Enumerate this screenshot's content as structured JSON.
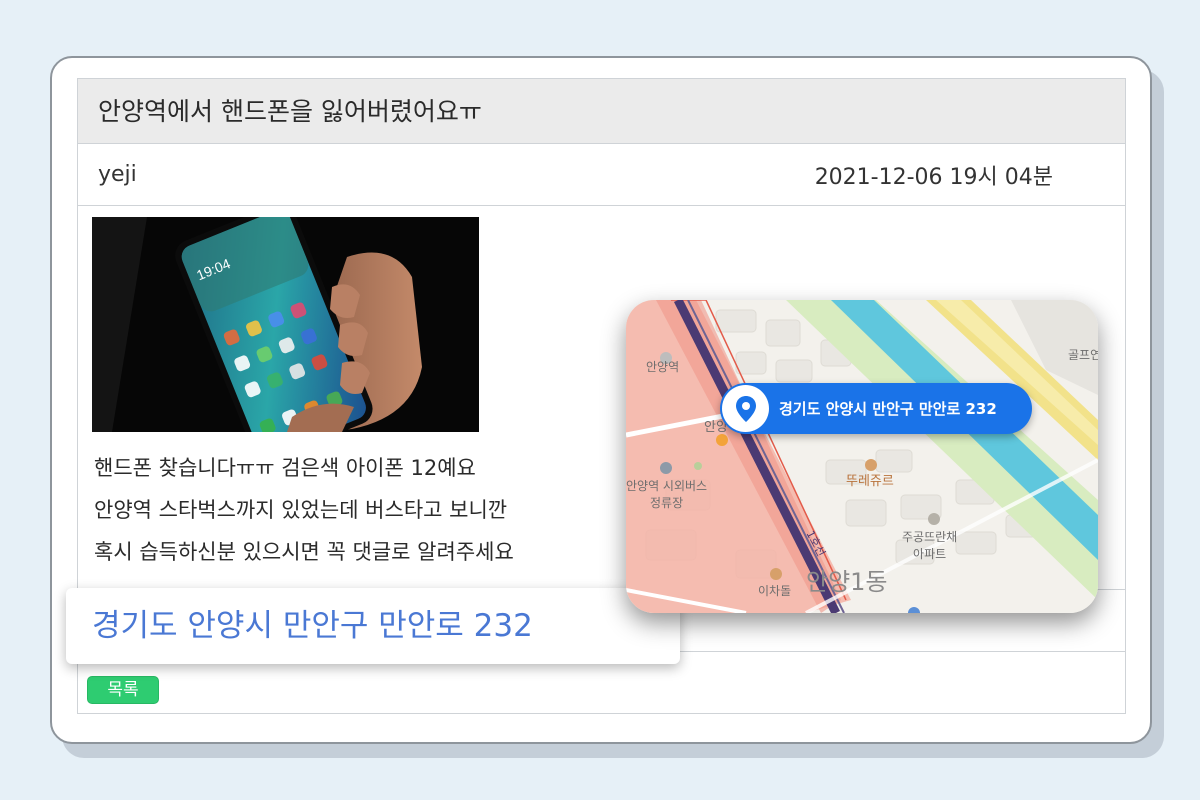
{
  "post": {
    "title": "안양역에서 핸드폰을 잃어버렸어요ㅠ",
    "author": "yeji",
    "timestamp": "2021-12-06 19시 04분",
    "body_lines": [
      "핸드폰 찾습니다ㅠㅠ 검은색 아이폰 12예요",
      "안양역 스타벅스까지 있었는데 버스타고 보니깐",
      "혹시 습득하신분 있으시면 꼭 댓글로 알려주세요"
    ],
    "list_button": "목록"
  },
  "phone_screen_time": "19:04",
  "address_callout": "경기도 안양시 만안구 만안로 232",
  "map": {
    "pin_address": "경기도 안양시 만안구 만안로 232",
    "labels": {
      "station_top": "안양역",
      "station_mid": "안양",
      "bus_stop": "안양역 시외버스\n정류장",
      "restaurant": "뚜레쥬르",
      "apartment": "주공뜨란채\n아파트",
      "district": "안양1동",
      "shop": "이차돌",
      "golf": "골프연",
      "rail_line": "1호선"
    },
    "colors": {
      "station_area": "#f4b3a6",
      "rail": "#4b3a73",
      "river": "#5fc7dd",
      "park": "#d8ecc0",
      "highway": "#f2e28a",
      "pill": "#1a73e8"
    }
  },
  "colors": {
    "background": "#e6f0f7",
    "title_bar": "#ebebeb",
    "list_button": "#2ecc71",
    "callout_text": "#4a78d4"
  }
}
